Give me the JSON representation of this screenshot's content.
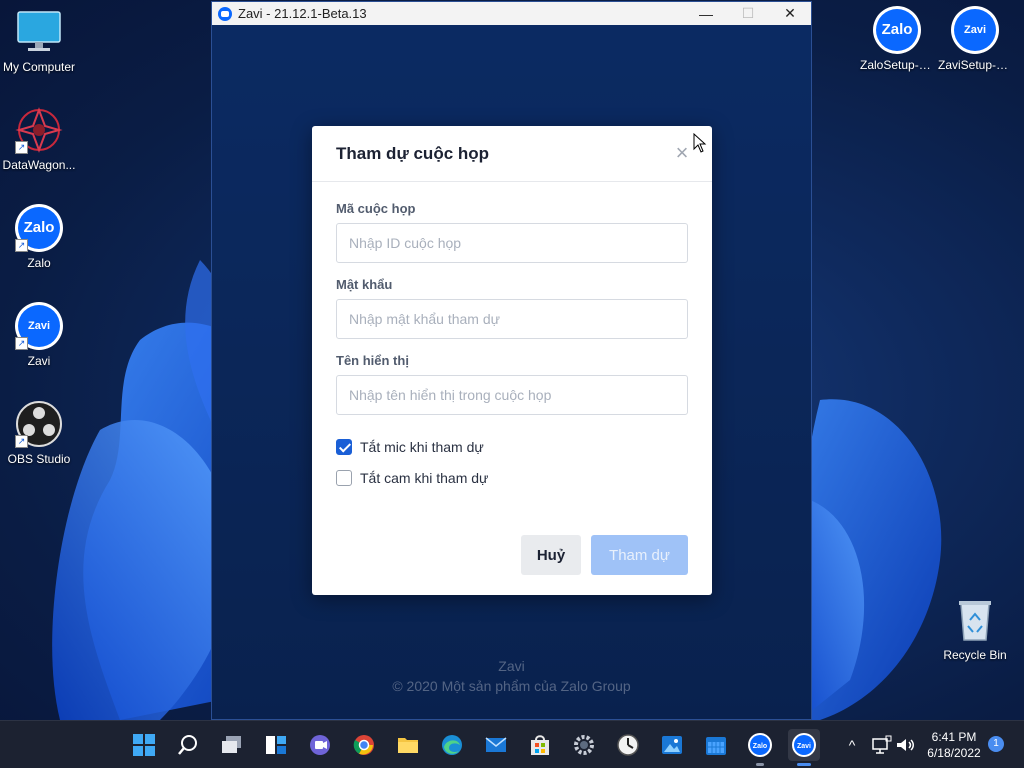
{
  "desktop": {
    "icons_left": [
      {
        "label": "My Computer",
        "icon": "monitor-icon"
      },
      {
        "label": "DataWagon...",
        "icon": "datawagon-icon"
      },
      {
        "label": "Zalo",
        "icon": "zalo-icon",
        "badge_text": "Zalo"
      },
      {
        "label": "Zavi",
        "icon": "zavi-icon",
        "badge_text": "Zavi"
      },
      {
        "label": "OBS Studio",
        "icon": "obs-icon"
      }
    ],
    "icons_right": [
      {
        "label": "ZaloSetup-2...",
        "icon": "zalo-icon",
        "badge_text": "Zalo"
      },
      {
        "label": "ZaviSetup-2...",
        "icon": "zavi-icon",
        "badge_text": "Zavi"
      }
    ],
    "recycle_bin": {
      "label": "Recycle Bin",
      "icon": "recycle-bin-icon"
    }
  },
  "window": {
    "title": "Zavi - 21.12.1-Beta.13",
    "minimize": "—",
    "maximize": "☐",
    "close": "✕",
    "footer_line1": "Zavi",
    "footer_line2": "© 2020 Một sản phẩm của Zalo Group"
  },
  "dialog": {
    "title": "Tham dự cuộc họp",
    "close": "×",
    "fields": [
      {
        "label": "Mã cuộc họp",
        "value": "",
        "placeholder": "Nhập ID cuộc họp"
      },
      {
        "label": "Mật khẩu",
        "value": "",
        "placeholder": "Nhập mật khẩu tham dự"
      },
      {
        "label": "Tên hiển thị",
        "value": "",
        "placeholder": "Nhập tên hiển thị trong cuộc họp"
      }
    ],
    "checkboxes": [
      {
        "label": "Tắt mic khi tham dự",
        "checked": true
      },
      {
        "label": "Tắt cam khi tham dự",
        "checked": false
      }
    ],
    "cancel_label": "Huỷ",
    "join_label": "Tham dự"
  },
  "taskbar": {
    "apps": [
      "start-icon",
      "search-icon",
      "task-view-icon",
      "widgets-icon",
      "teams-chat-icon",
      "chrome-icon",
      "file-explorer-icon",
      "edge-icon",
      "mail-icon",
      "store-icon",
      "settings-icon",
      "clock-app-icon",
      "photos-icon",
      "calendar-icon",
      "zalo-icon",
      "zavi-icon"
    ],
    "active_app": "zavi-icon",
    "time": "6:41 PM",
    "date": "6/18/2022",
    "notification_count": "1",
    "tray_chevron": "^"
  },
  "colors": {
    "accent": "#1a5fd6",
    "zalo_blue": "#0a68ff",
    "join_disabled": "#9fc2f7",
    "window_bg": "#0e3476"
  }
}
